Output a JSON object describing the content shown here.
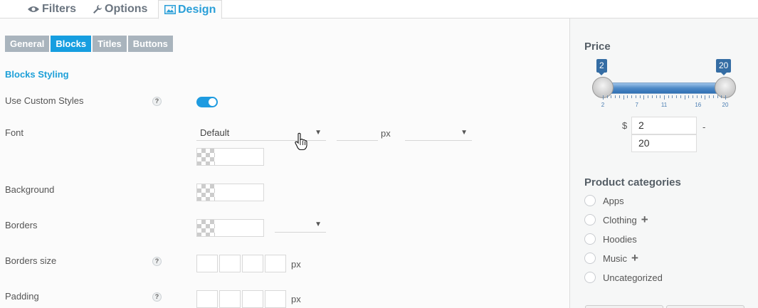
{
  "top_tabs": [
    {
      "label": "Filters",
      "icon": "eye-icon"
    },
    {
      "label": "Options",
      "icon": "wrench-icon"
    },
    {
      "label": "Design",
      "icon": "image-icon",
      "active": true
    }
  ],
  "sub_tabs": [
    {
      "label": "General"
    },
    {
      "label": "Blocks",
      "active": true
    },
    {
      "label": "Titles"
    },
    {
      "label": "Buttons"
    }
  ],
  "section_title": "Blocks Styling",
  "fields": {
    "use_custom_styles": {
      "label": "Use Custom Styles",
      "help": "?",
      "enabled": true
    },
    "font": {
      "label": "Font",
      "family": "Default",
      "size_unit": "px"
    },
    "background": {
      "label": "Background"
    },
    "borders": {
      "label": "Borders"
    },
    "borders_size": {
      "label": "Borders size",
      "help": "?",
      "unit": "px"
    },
    "padding": {
      "label": "Padding",
      "help": "?",
      "unit": "px"
    }
  },
  "preview": {
    "price": {
      "title": "Price",
      "min_label": "2",
      "max_label": "20",
      "ticks": [
        "2",
        "7",
        "11",
        "16",
        "20"
      ],
      "currency": "$",
      "min_value": "2",
      "max_value": "20",
      "separator": "-"
    },
    "categories": {
      "title": "Product categories",
      "items": [
        {
          "label": "Apps",
          "expandable": false
        },
        {
          "label": "Clothing",
          "expandable": true
        },
        {
          "label": "Hoodies",
          "expandable": false
        },
        {
          "label": "Music",
          "expandable": true
        },
        {
          "label": "Uncategorized",
          "expandable": false
        }
      ],
      "plus": "+"
    }
  },
  "colors": {
    "accent": "#169ee0",
    "tab_inactive": "#a9b4bd",
    "slider": "#356da4"
  }
}
